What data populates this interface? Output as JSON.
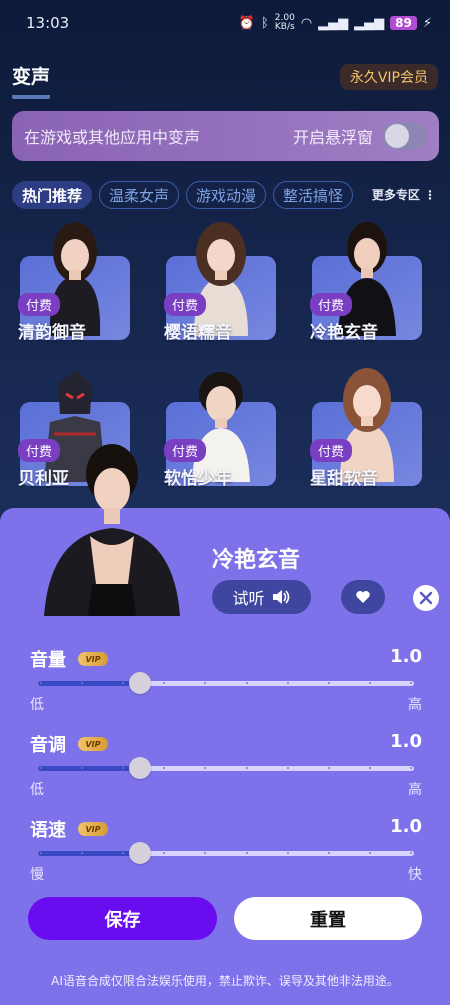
{
  "status_bar": {
    "time": "13:03",
    "speed": "2.00",
    "speed_unit": "KB/s",
    "battery": "89"
  },
  "header": {
    "title": "变声",
    "vip": "永久VIP会员"
  },
  "float_banner": {
    "text": "在游戏或其他应用中变声",
    "toggle_label": "开启悬浮窗",
    "toggle_on": false
  },
  "tabs": [
    "热门推荐",
    "温柔女声",
    "游戏动漫",
    "整活搞怪"
  ],
  "more_label": "更多专区 ⋮",
  "cards": [
    {
      "tag": "付费",
      "name": "清韵御音"
    },
    {
      "tag": "付费",
      "name": "樱语糯音"
    },
    {
      "tag": "付费",
      "name": "冷艳玄音"
    },
    {
      "tag": "付费",
      "name": "贝利亚"
    },
    {
      "tag": "付费",
      "name": "软怡少年"
    },
    {
      "tag": "付费",
      "name": "星甜软音"
    }
  ],
  "sheet": {
    "title": "冷艳玄音",
    "listen_label": "试听",
    "sliders": [
      {
        "label": "音量",
        "vip": "VIP",
        "value": "1.0",
        "min_label": "低",
        "max_label": "高",
        "level": 0.27
      },
      {
        "label": "音调",
        "vip": "VIP",
        "value": "1.0",
        "min_label": "低",
        "max_label": "高",
        "level": 0.27
      },
      {
        "label": "语速",
        "vip": "VIP",
        "value": "1.0",
        "min_label": "慢",
        "max_label": "快",
        "level": 0.27
      }
    ],
    "save_label": "保存",
    "reset_label": "重置",
    "disclaimer": "AI语音合成仅限合法娱乐使用，禁止欺诈、误导及其他非法用途。"
  },
  "colors": {
    "accent": "#6a0cf0",
    "sheet_bg": "#7e72ea",
    "tag_bg": "#7a3ec2",
    "vip_gold": "#f3c36c"
  }
}
